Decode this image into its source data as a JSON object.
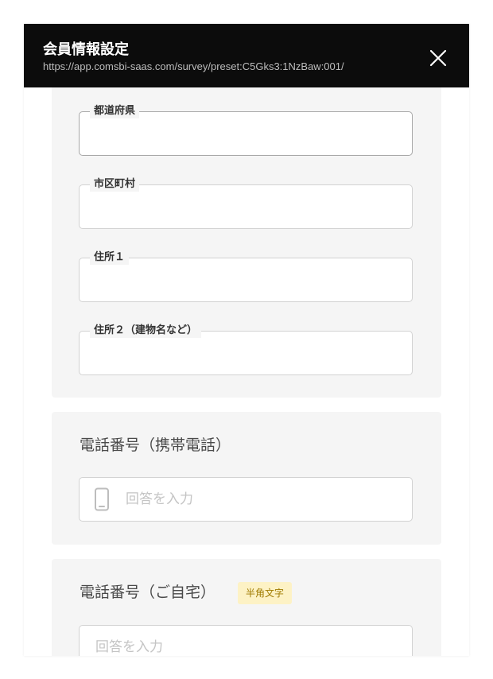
{
  "header": {
    "title": "会員情報設定",
    "url": "https://app.comsbi-saas.com/survey/preset:C5Gks3:1NzBaw:001/",
    "close_icon": "close-icon"
  },
  "address_section": {
    "fields": [
      {
        "label": "都道府県",
        "value": ""
      },
      {
        "label": "市区町村",
        "value": ""
      },
      {
        "label": "住所１",
        "value": ""
      },
      {
        "label": "住所２（建物名など）",
        "value": ""
      }
    ]
  },
  "mobile_phone": {
    "title": "電話番号（携帯電話）",
    "placeholder": "回答を入力",
    "icon": "smartphone-icon"
  },
  "home_phone": {
    "title": "電話番号（ご自宅）",
    "badge": "半角文字",
    "placeholder": "回答を入力"
  },
  "colors": {
    "header_bg": "#0c0c0c",
    "card_bg": "#f5f5f5",
    "badge_bg": "#fdf2c5",
    "badge_text": "#a07b00"
  }
}
